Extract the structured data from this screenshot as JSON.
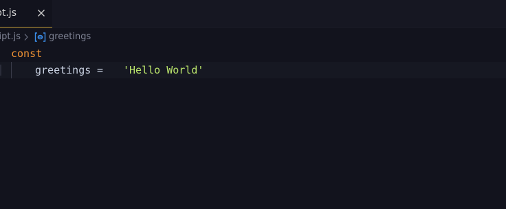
{
  "tab": {
    "label": "script.js",
    "close_label": "✕"
  },
  "breadcrumb": {
    "file": "script.js",
    "separator": "›",
    "symbol": "greetings",
    "symbol_icon": "variable-icon"
  },
  "code": {
    "line1": {
      "keyword": "const"
    },
    "line2": {
      "identifier": "greetings",
      "operator": "=",
      "string": "'Hello World'"
    }
  },
  "colors": {
    "background": "#12131d",
    "keyword": "#f29434",
    "string": "#b9e36b",
    "identifier": "#c8d0e0",
    "tab_accent": "#c7a13a",
    "symbol_icon": "#3b8eea"
  }
}
